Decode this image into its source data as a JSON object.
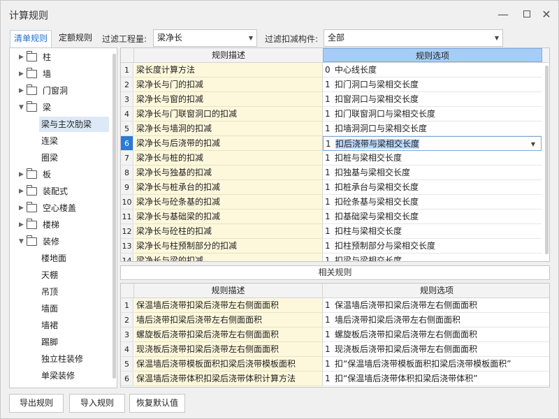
{
  "window": {
    "title": "计算规则"
  },
  "toolbar": {
    "tabs": [
      {
        "label": "清单规则"
      },
      {
        "label": "定额规则"
      }
    ],
    "filter_quantity_label": "过滤工程量:",
    "filter_quantity_value": "梁净长",
    "filter_deduct_label": "过滤扣减构件:",
    "filter_deduct_value": "全部"
  },
  "tree": {
    "nodes": [
      {
        "label": "柱"
      },
      {
        "label": "墙"
      },
      {
        "label": "门窗洞"
      },
      {
        "label": "梁",
        "children": [
          "梁与主次肋梁",
          "连梁",
          "圈梁"
        ]
      },
      {
        "label": "板"
      },
      {
        "label": "装配式"
      },
      {
        "label": "空心楼盖"
      },
      {
        "label": "楼梯"
      },
      {
        "label": "装修",
        "children": [
          "楼地面",
          "天棚",
          "吊顶",
          "墙面",
          "墙裙",
          "踢脚",
          "独立柱装修",
          "单梁装修"
        ]
      }
    ],
    "selected": "梁与主次肋梁"
  },
  "rules_table": {
    "headers": [
      "规则描述",
      "规则选项"
    ],
    "rows": [
      {
        "no": "1",
        "desc": "梁长度计算方法",
        "val": "0",
        "option": "中心线长度"
      },
      {
        "no": "2",
        "desc": "梁净长与门的扣减",
        "val": "1",
        "option": "扣门洞口与梁相交长度"
      },
      {
        "no": "3",
        "desc": "梁净长与窗的扣减",
        "val": "1",
        "option": "扣窗洞口与梁相交长度"
      },
      {
        "no": "4",
        "desc": "梁净长与门联窗洞口的扣减",
        "val": "1",
        "option": "扣门联窗洞口与梁相交长度"
      },
      {
        "no": "5",
        "desc": "梁净长与墙洞的扣减",
        "val": "1",
        "option": "扣墙洞洞口与梁相交长度"
      },
      {
        "no": "6",
        "desc": "梁净长与后浇带的扣减",
        "val": "1",
        "option": "扣后浇带与梁相交长度"
      },
      {
        "no": "7",
        "desc": "梁净长与桩的扣减",
        "val": "1",
        "option": "扣桩与梁相交长度"
      },
      {
        "no": "8",
        "desc": "梁净长与独基的扣减",
        "val": "1",
        "option": "扣独基与梁相交长度"
      },
      {
        "no": "9",
        "desc": "梁净长与桩承台的扣减",
        "val": "1",
        "option": "扣桩承台与梁相交长度"
      },
      {
        "no": "10",
        "desc": "梁净长与砼条基的扣减",
        "val": "1",
        "option": "扣砼条基与梁相交长度"
      },
      {
        "no": "11",
        "desc": "梁净长与基础梁的扣减",
        "val": "1",
        "option": "扣基础梁与梁相交长度"
      },
      {
        "no": "12",
        "desc": "梁净长与砼柱的扣减",
        "val": "1",
        "option": "扣柱与梁相交长度"
      },
      {
        "no": "13",
        "desc": "梁净长与柱预制部分的扣减",
        "val": "1",
        "option": "扣柱预制部分与梁相交长度"
      },
      {
        "no": "14",
        "desc": "梁净长与梁的扣减",
        "val": "1",
        "option": "扣梁与梁相交长度"
      }
    ],
    "current_row": 6
  },
  "related": {
    "button_label": "相关规则",
    "headers": [
      "规则描述",
      "规则选项"
    ],
    "rows": [
      {
        "no": "1",
        "desc": "保温墙后浇带扣梁后浇带左右侧面面积",
        "val": "1",
        "option": "保温墙后浇带扣梁后浇带左右侧面面积"
      },
      {
        "no": "2",
        "desc": "墙后浇带扣梁后浇带左右侧面面积",
        "val": "1",
        "option": "墙后浇带扣梁后浇带左右侧面面积"
      },
      {
        "no": "3",
        "desc": "螺旋板后浇带扣梁后浇带左右侧面面积",
        "val": "1",
        "option": "螺旋板后浇带扣梁后浇带左右侧面面积"
      },
      {
        "no": "4",
        "desc": "现浇板后浇带扣梁后浇带左右侧面面积",
        "val": "1",
        "option": "现浇板后浇带扣梁后浇带左右侧面面积"
      },
      {
        "no": "5",
        "desc": "保温墙后浇带模板面积扣梁后浇带模板面积",
        "val": "1",
        "option": "扣“保温墙后浇带模板面积扣梁后浇带模板面积”"
      },
      {
        "no": "6",
        "desc": "保温墙后浇带体积扣梁后浇带体积计算方法",
        "val": "1",
        "option": "扣“保温墙后浇带体积扣梁后浇带体积”"
      }
    ]
  },
  "footer": {
    "export_label": "导出规则",
    "import_label": "导入规则",
    "restore_label": "恢复默认值"
  }
}
